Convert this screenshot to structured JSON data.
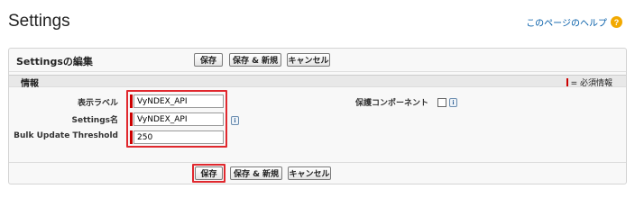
{
  "page": {
    "title": "Settings",
    "help_link": "このページのヘルプ"
  },
  "panel": {
    "title": "Settingsの編集",
    "buttons": {
      "save": "保存",
      "save_new": "保存 & 新規",
      "cancel": "キャンセル"
    }
  },
  "section": {
    "title": "情報",
    "required_legend": "= 必須情報"
  },
  "fields": {
    "display_label": {
      "label": "表示ラベル",
      "value": "VyNDEX_API"
    },
    "settings_name": {
      "label": "Settings名",
      "value": "VyNDEX_API"
    },
    "bulk_threshold": {
      "label": "Bulk Update Threshold",
      "value": "250"
    },
    "protected_component": {
      "label": "保護コンポーネント",
      "checked": false
    }
  },
  "colors": {
    "required": "#cc0000",
    "highlight": "#e0282e",
    "link": "#015ba7"
  },
  "icons": [
    "help-icon",
    "info-icon",
    "checkbox"
  ]
}
